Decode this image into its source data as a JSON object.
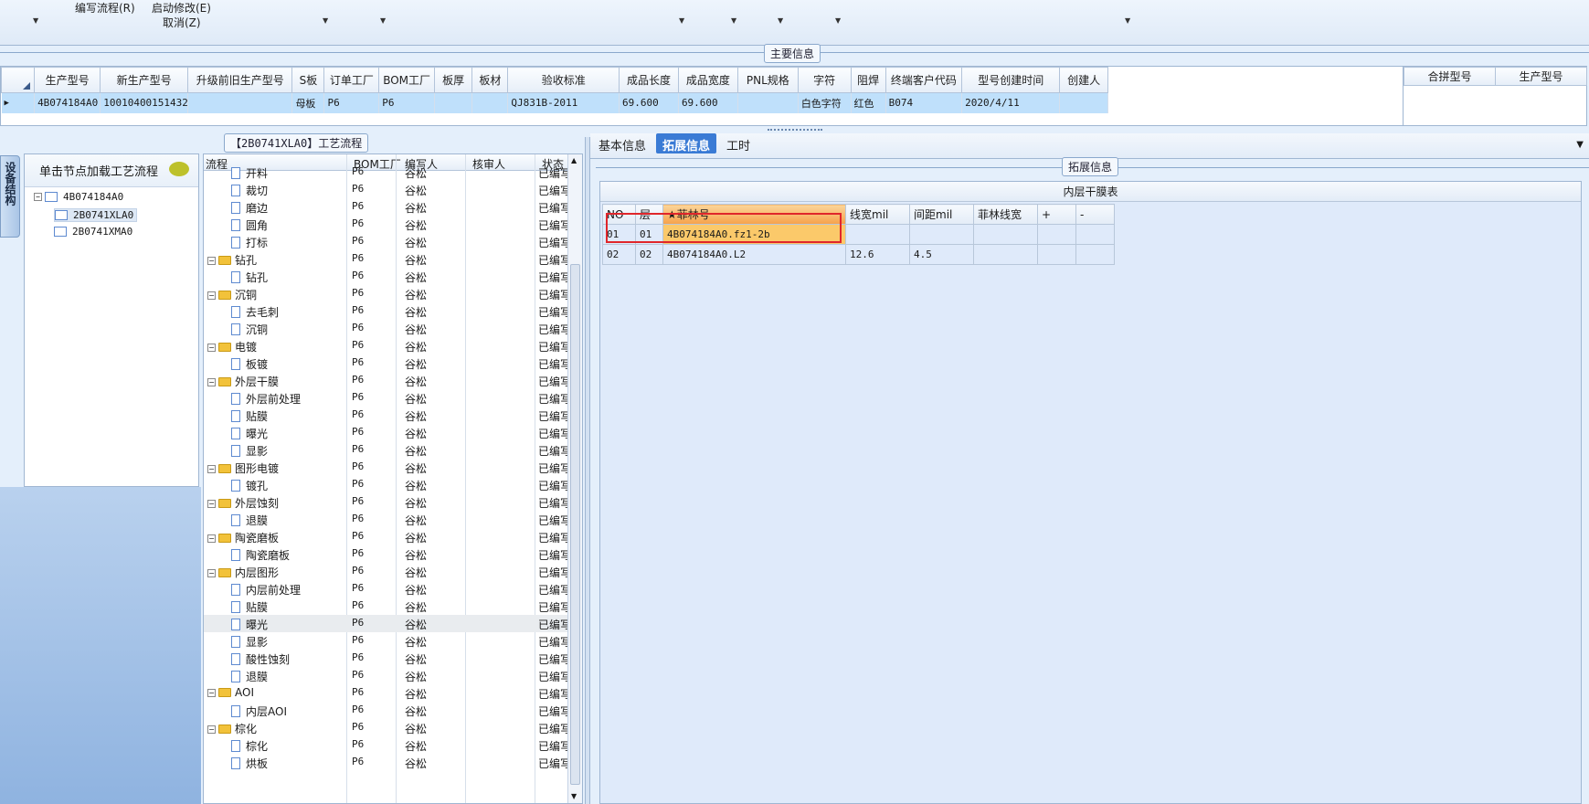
{
  "toolbar": {
    "write_flow": "编写流程(R)",
    "start_modify": "启动修改(E)",
    "cancel": "取消(Z)"
  },
  "main_info": {
    "title": "主要信息",
    "columns": [
      "生产型号",
      "新生产型号",
      "升级前旧生产型号",
      "S板",
      "订单工厂",
      "BOM工厂",
      "板厚",
      "板材",
      "验收标准",
      "成品长度",
      "成品宽度",
      "PNL规格",
      "字符",
      "阻焊",
      "终端客户代码",
      "型号创建时间",
      "创建人"
    ],
    "row": [
      "4B074184A0",
      "10010400151432",
      "",
      "母板",
      "P6",
      "P6",
      "",
      "",
      "QJ831B-2011",
      "69.600",
      "69.600",
      "",
      "白色字符",
      "红色",
      "B074",
      "2020/4/11",
      ""
    ],
    "merge_columns": [
      "合拼型号",
      "生产型号"
    ]
  },
  "left_tab": {
    "label": "设备结构"
  },
  "left_panel": {
    "header": "单击节点加载工艺流程",
    "tree": [
      {
        "label": "4B074184A0",
        "level": 0
      },
      {
        "label": "2B0741XLA0",
        "level": 1,
        "selected": true
      },
      {
        "label": "2B0741XMA0",
        "level": 1
      }
    ]
  },
  "flow_panel": {
    "title": "【2B0741XLA0】工艺流程",
    "columns": [
      "流程",
      "BOM工厂",
      "编写人",
      "核审人",
      "状态"
    ],
    "rows": [
      {
        "name": "开料",
        "folder": false,
        "bom": "P6",
        "writer": "谷松",
        "status": "已编写"
      },
      {
        "name": "裁切",
        "folder": false,
        "bom": "P6",
        "writer": "谷松",
        "status": "已编写"
      },
      {
        "name": "磨边",
        "folder": false,
        "bom": "P6",
        "writer": "谷松",
        "status": "已编写"
      },
      {
        "name": "圆角",
        "folder": false,
        "bom": "P6",
        "writer": "谷松",
        "status": "已编写"
      },
      {
        "name": "打标",
        "folder": false,
        "bom": "P6",
        "writer": "谷松",
        "status": "已编写"
      },
      {
        "name": "钻孔",
        "folder": true,
        "bom": "P6",
        "writer": "谷松",
        "status": "已编写"
      },
      {
        "name": "钻孔",
        "folder": false,
        "bom": "P6",
        "writer": "谷松",
        "status": "已编写"
      },
      {
        "name": "沉铜",
        "folder": true,
        "bom": "P6",
        "writer": "谷松",
        "status": "已编写"
      },
      {
        "name": "去毛刺",
        "folder": false,
        "bom": "P6",
        "writer": "谷松",
        "status": "已编写"
      },
      {
        "name": "沉铜",
        "folder": false,
        "bom": "P6",
        "writer": "谷松",
        "status": "已编写"
      },
      {
        "name": "电镀",
        "folder": true,
        "bom": "P6",
        "writer": "谷松",
        "status": "已编写"
      },
      {
        "name": "板镀",
        "folder": false,
        "bom": "P6",
        "writer": "谷松",
        "status": "已编写"
      },
      {
        "name": "外层干膜",
        "folder": true,
        "bom": "P6",
        "writer": "谷松",
        "status": "已编写"
      },
      {
        "name": "外层前处理",
        "folder": false,
        "bom": "P6",
        "writer": "谷松",
        "status": "已编写"
      },
      {
        "name": "贴膜",
        "folder": false,
        "bom": "P6",
        "writer": "谷松",
        "status": "已编写"
      },
      {
        "name": "曝光",
        "folder": false,
        "bom": "P6",
        "writer": "谷松",
        "status": "已编写"
      },
      {
        "name": "显影",
        "folder": false,
        "bom": "P6",
        "writer": "谷松",
        "status": "已编写"
      },
      {
        "name": "图形电镀",
        "folder": true,
        "bom": "P6",
        "writer": "谷松",
        "status": "已编写"
      },
      {
        "name": "镀孔",
        "folder": false,
        "bom": "P6",
        "writer": "谷松",
        "status": "已编写"
      },
      {
        "name": "外层蚀刻",
        "folder": true,
        "bom": "P6",
        "writer": "谷松",
        "status": "已编写"
      },
      {
        "name": "退膜",
        "folder": false,
        "bom": "P6",
        "writer": "谷松",
        "status": "已编写"
      },
      {
        "name": "陶瓷磨板",
        "folder": true,
        "bom": "P6",
        "writer": "谷松",
        "status": "已编写"
      },
      {
        "name": "陶瓷磨板",
        "folder": false,
        "bom": "P6",
        "writer": "谷松",
        "status": "已编写"
      },
      {
        "name": "内层图形",
        "folder": true,
        "bom": "P6",
        "writer": "谷松",
        "status": "已编写"
      },
      {
        "name": "内层前处理",
        "folder": false,
        "bom": "P6",
        "writer": "谷松",
        "status": "已编写"
      },
      {
        "name": "贴膜",
        "folder": false,
        "bom": "P6",
        "writer": "谷松",
        "status": "已编写"
      },
      {
        "name": "曝光",
        "folder": false,
        "bom": "P6",
        "writer": "谷松",
        "status": "已编写",
        "highlight": true
      },
      {
        "name": "显影",
        "folder": false,
        "bom": "P6",
        "writer": "谷松",
        "status": "已编写"
      },
      {
        "name": "酸性蚀刻",
        "folder": false,
        "bom": "P6",
        "writer": "谷松",
        "status": "已编写"
      },
      {
        "name": "退膜",
        "folder": false,
        "bom": "P6",
        "writer": "谷松",
        "status": "已编写"
      },
      {
        "name": "AOI",
        "folder": true,
        "bom": "P6",
        "writer": "谷松",
        "status": "已编写"
      },
      {
        "name": "内层AOI",
        "folder": false,
        "bom": "P6",
        "writer": "谷松",
        "status": "已编写"
      },
      {
        "name": "棕化",
        "folder": true,
        "bom": "P6",
        "writer": "谷松",
        "status": "已编写"
      },
      {
        "name": "棕化",
        "folder": false,
        "bom": "P6",
        "writer": "谷松",
        "status": "已编写"
      },
      {
        "name": "烘板",
        "folder": false,
        "bom": "P6",
        "writer": "谷松",
        "status": "已编写"
      }
    ]
  },
  "right_panel": {
    "tabs": [
      "基本信息",
      "拓展信息",
      "工时"
    ],
    "active_tab": "拓展信息",
    "group_title": "拓展信息",
    "table_title": "内层干膜表",
    "columns": [
      "NO",
      "层",
      "★菲林号",
      "线宽mil",
      "间距mil",
      "菲林线宽",
      "+",
      "-"
    ],
    "rows": [
      [
        "01",
        "01",
        "4B074184A0.fz1-2b",
        "",
        "",
        "",
        "",
        ""
      ],
      [
        "02",
        "02",
        "4B074184A0.L2",
        "12.6",
        "4.5",
        "",
        "",
        ""
      ]
    ]
  },
  "colors": {
    "highlight_cell": "#fbc96a",
    "selection_box": "#e0262b",
    "active_tab": "#3a7bd5",
    "selected_row": "#bfe0fb"
  }
}
